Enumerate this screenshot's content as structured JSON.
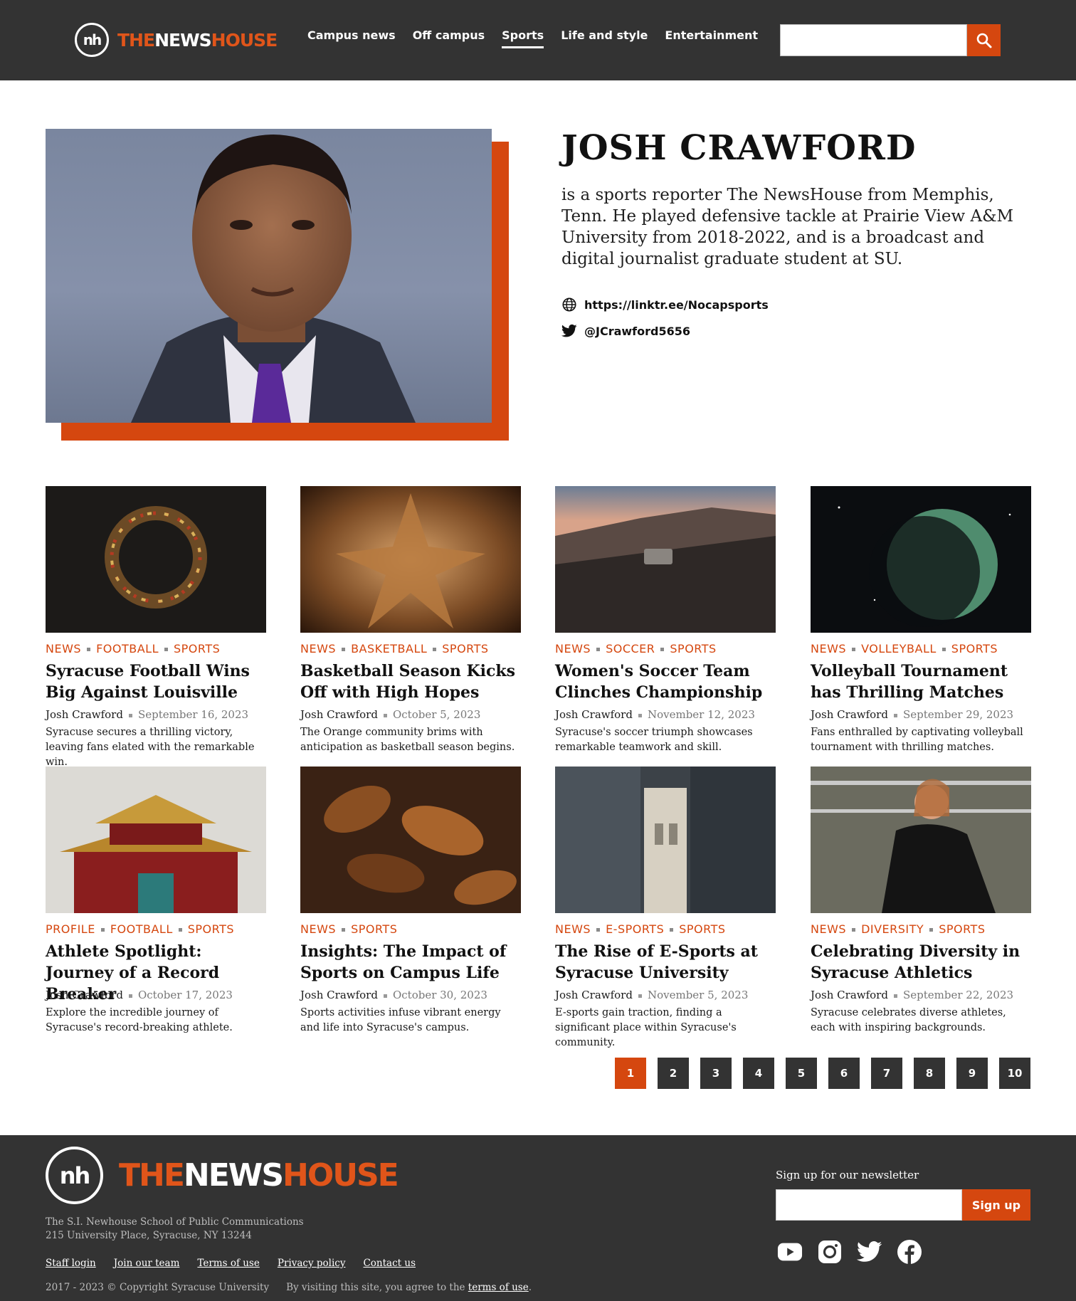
{
  "header": {
    "logo_mark": "nh",
    "logo_the": "THE",
    "logo_news": "NEWS",
    "logo_house": "HOUSE",
    "nav": [
      "Campus news",
      "Off campus",
      "Sports",
      "Life and style",
      "Entertainment"
    ],
    "active_nav": "Sports",
    "search_placeholder": ""
  },
  "author": {
    "name": "JOSH CRAWFORD",
    "bio": "is a sports reporter The NewsHouse from Memphis, Tenn. He played defensive tackle at Prairie View A&M University from 2018-2022, and is a broadcast and digital journalist graduate student at SU.",
    "website": "https://linktr.ee/Nocapsports",
    "twitter": "@JCrawford5656"
  },
  "articles": [
    {
      "tags": [
        "NEWS",
        "FOOTBALL",
        "SPORTS"
      ],
      "title": "Syracuse Football Wins Big Against Louisville",
      "author": "Josh Crawford",
      "date": "September 16, 2023",
      "desc": "Syracuse secures a thrilling victory, leaving fans elated with the remarkable win."
    },
    {
      "tags": [
        "NEWS",
        "BASKETBALL",
        "SPORTS"
      ],
      "title": "Basketball Season Kicks Off with High Hopes",
      "author": "Josh Crawford",
      "date": "October 5, 2023",
      "desc": "The Orange community brims with anticipation as basketball season begins."
    },
    {
      "tags": [
        "NEWS",
        "SOCCER",
        "SPORTS"
      ],
      "title": "Women's Soccer Team Clinches Championship",
      "author": "Josh Crawford",
      "date": "November 12, 2023",
      "desc": "Syracuse's soccer triumph showcases remarkable teamwork and skill."
    },
    {
      "tags": [
        "NEWS",
        "VOLLEYBALL",
        "SPORTS"
      ],
      "title": "Volleyball Tournament has Thrilling Matches",
      "author": "Josh Crawford",
      "date": "September 29, 2023",
      "desc": "Fans enthralled by captivating volleyball tournament with thrilling matches."
    },
    {
      "tags": [
        "PROFILE",
        "FOOTBALL",
        "SPORTS"
      ],
      "title": "Athlete Spotlight: Journey of a Record Breaker",
      "author": "Josh Crawford",
      "date": "October 17, 2023",
      "desc": "Explore the incredible journey of Syracuse's record-breaking athlete."
    },
    {
      "tags": [
        "NEWS",
        "SPORTS"
      ],
      "title": "Insights: The Impact of Sports on Campus Life",
      "author": "Josh Crawford",
      "date": "October 30, 2023",
      "desc": "Sports activities infuse vibrant energy and life into Syracuse's campus."
    },
    {
      "tags": [
        "NEWS",
        "E-SPORTS",
        "SPORTS"
      ],
      "title": "The Rise of E-Sports at Syracuse University",
      "author": "Josh Crawford",
      "date": "November 5, 2023",
      "desc": "E-sports gain traction, finding a significant place within Syracuse's community."
    },
    {
      "tags": [
        "NEWS",
        "DIVERSITY",
        "SPORTS"
      ],
      "title": "Celebrating Diversity in Syracuse Athletics",
      "author": "Josh Crawford",
      "date": "September 22, 2023",
      "desc": "Syracuse celebrates diverse athletes, each with inspiring backgrounds."
    }
  ],
  "pagination": {
    "pages": [
      "1",
      "2",
      "3",
      "4",
      "5",
      "6",
      "7",
      "8",
      "9",
      "10"
    ],
    "current": "1"
  },
  "footer": {
    "address_line1": "The S.I. Newhouse School of Public Communications",
    "address_line2": "215 University Place, Syracuse, NY 13244",
    "links": [
      "Staff login",
      "Join our team",
      "Terms of use",
      "Privacy policy",
      "Contact us"
    ],
    "copyright": "2017 - 2023 © Copyright Syracuse University",
    "visiting_text": "By visiting this site, you agree to the ",
    "terms_link": "terms of use",
    "terms_period": ".",
    "newsletter_label": "Sign up for our newsletter",
    "newsletter_button": "Sign up",
    "socials": [
      "youtube-icon",
      "instagram-icon",
      "twitter-icon",
      "facebook-icon"
    ]
  },
  "colors": {
    "accent": "#d5470f",
    "dark": "#333333"
  }
}
